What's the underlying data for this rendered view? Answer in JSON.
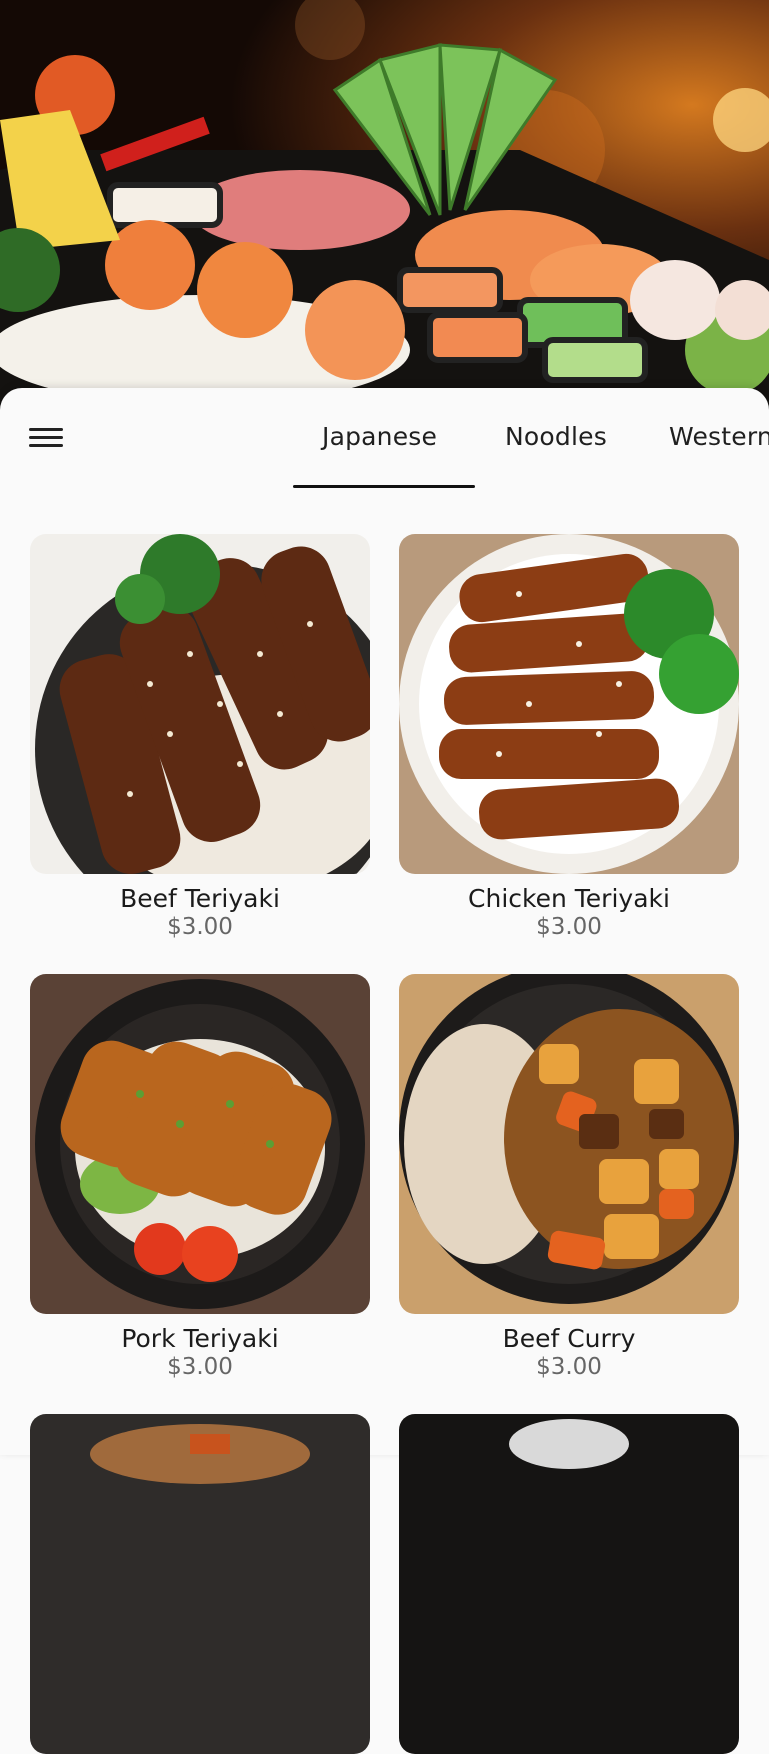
{
  "hero": {
    "image": "sushi-platter"
  },
  "nav": {
    "menu_icon": "hamburger-menu-icon",
    "tabs": [
      {
        "label": "Japanese",
        "selected": true
      },
      {
        "label": "Noodles"
      },
      {
        "label": "Western"
      }
    ]
  },
  "products": [
    {
      "name": "Beef Teriyaki",
      "price": "$3.00",
      "image": "beef-teriyaki-bowl"
    },
    {
      "name": "Chicken Teriyaki",
      "price": "$3.00",
      "image": "chicken-teriyaki-bowl"
    },
    {
      "name": "Pork Teriyaki",
      "price": "$3.00",
      "image": "pork-teriyaki-bowl"
    },
    {
      "name": "Beef Curry",
      "price": "$3.00",
      "image": "beef-curry-bowl"
    },
    {
      "image": "food-bowl"
    },
    {
      "image": "food-bowl"
    }
  ],
  "colors": {
    "accent": "#111111",
    "price": "#666666",
    "background": "#fafafa"
  }
}
